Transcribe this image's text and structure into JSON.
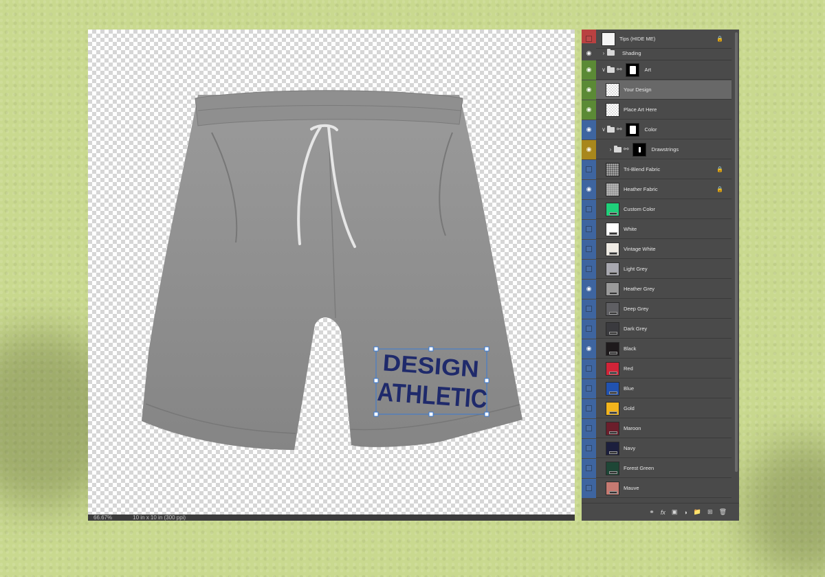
{
  "statusbar": {
    "zoom": "66.67%",
    "doc_info": "10 in x 10 in (300 ppi)"
  },
  "artwork": {
    "line1": "DESIGN",
    "line2": "ATHLETIC",
    "ink_color": "#1f2a6b",
    "fabric_color": "#8e8e8e"
  },
  "layers": [
    {
      "name": "Tips (HIDE ME)",
      "tag": "#b94141",
      "visible": false,
      "type": "tips",
      "locked": true
    },
    {
      "name": "Shading",
      "tag": "#4a4a4a",
      "visible": true,
      "type": "group",
      "indent": 0
    },
    {
      "name": "Art",
      "tag": "#5b8a35",
      "visible": true,
      "type": "group-mask",
      "indent": 0,
      "open": true
    },
    {
      "name": "Your Design",
      "tag": "#5b8a35",
      "visible": true,
      "type": "smart",
      "selected": true
    },
    {
      "name": "Place Art Here",
      "tag": "#5b8a35",
      "visible": true,
      "type": "trans"
    },
    {
      "name": "Color",
      "tag": "#3e65a0",
      "visible": true,
      "type": "group-mask",
      "indent": 0,
      "open": true
    },
    {
      "name": "Drawstrings",
      "tag": "#a8871c",
      "visible": true,
      "type": "group-mask-small",
      "indent": 1
    },
    {
      "name": "Tri-Blend Fabric",
      "tag": "#3e65a0",
      "visible": false,
      "type": "fabric",
      "locked": true,
      "swatch": "#6a6a6a"
    },
    {
      "name": "Heather Fabric",
      "tag": "#3e65a0",
      "visible": true,
      "type": "fabric",
      "locked": true,
      "swatch": "#9a9a9a"
    },
    {
      "name": "Custom Color",
      "tag": "#3e65a0",
      "visible": false,
      "type": "color",
      "swatch": "#1fd07a"
    },
    {
      "name": "White",
      "tag": "#3e65a0",
      "visible": false,
      "type": "color",
      "swatch": "#ffffff"
    },
    {
      "name": "Vintage White",
      "tag": "#3e65a0",
      "visible": false,
      "type": "color",
      "swatch": "#efebe4"
    },
    {
      "name": "Light Grey",
      "tag": "#3e65a0",
      "visible": false,
      "type": "color",
      "swatch": "#a8a8b0"
    },
    {
      "name": "Heather Grey",
      "tag": "#3e65a0",
      "visible": true,
      "type": "color",
      "swatch": "#9a9a9a"
    },
    {
      "name": "Deep Grey",
      "tag": "#3e65a0",
      "visible": false,
      "type": "color",
      "swatch": "#5f5f63"
    },
    {
      "name": "Dark Grey",
      "tag": "#3e65a0",
      "visible": false,
      "type": "color",
      "swatch": "#3a3a3e"
    },
    {
      "name": "Black",
      "tag": "#3e65a0",
      "visible": true,
      "type": "color",
      "swatch": "#1e1a1c"
    },
    {
      "name": "Red",
      "tag": "#3e65a0",
      "visible": false,
      "type": "color",
      "swatch": "#d12438"
    },
    {
      "name": "Blue",
      "tag": "#3e65a0",
      "visible": false,
      "type": "color",
      "swatch": "#2152b0"
    },
    {
      "name": "Gold",
      "tag": "#3e65a0",
      "visible": false,
      "type": "color",
      "swatch": "#f2b41c"
    },
    {
      "name": "Maroon",
      "tag": "#3e65a0",
      "visible": false,
      "type": "color",
      "swatch": "#6b1e2b"
    },
    {
      "name": "Navy",
      "tag": "#3e65a0",
      "visible": false,
      "type": "color",
      "swatch": "#1c1f3d"
    },
    {
      "name": "Forest Green",
      "tag": "#3e65a0",
      "visible": false,
      "type": "color",
      "swatch": "#1e4636"
    },
    {
      "name": "Mauve",
      "tag": "#3e65a0",
      "visible": false,
      "type": "color",
      "swatch": "#c67a72"
    }
  ],
  "footer_icons": [
    "link-layers-icon",
    "fx-icon",
    "add-mask-icon",
    "adjustment-layer-icon",
    "new-group-icon",
    "new-layer-icon",
    "delete-layer-icon"
  ],
  "footer_labels": {
    "fx": "fx"
  }
}
